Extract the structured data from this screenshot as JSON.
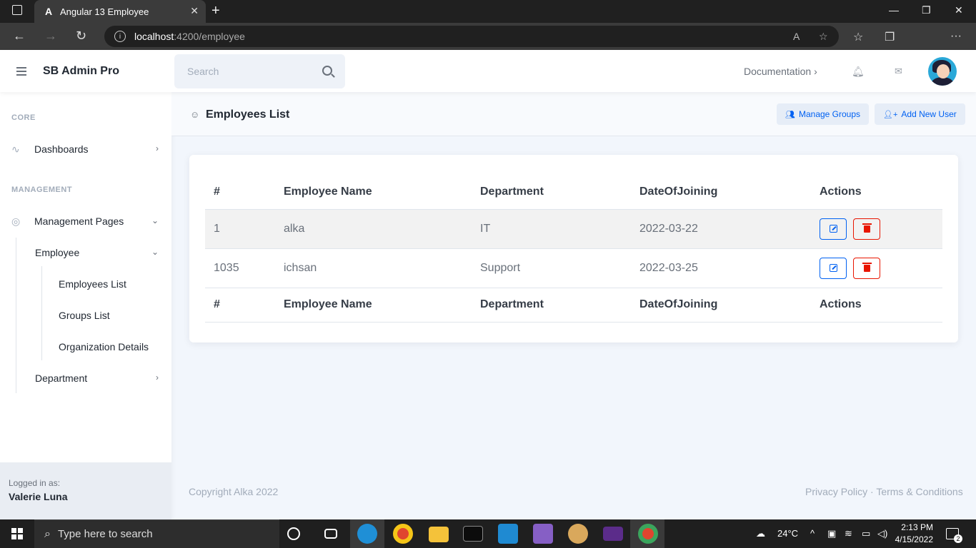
{
  "browser": {
    "tab_title": "Angular 13 Employee",
    "url_host": "localhost",
    "url_path": ":4200/employee"
  },
  "app": {
    "brand": "SB Admin Pro",
    "search_placeholder": "Search",
    "documentation": "Documentation"
  },
  "sidebar": {
    "core_heading": "CORE",
    "dashboards": "Dashboards",
    "management_heading": "MANAGEMENT",
    "management_pages": "Management Pages",
    "employee": "Employee",
    "employees_list": "Employees List",
    "groups_list": "Groups List",
    "organization_details": "Organization Details",
    "department": "Department",
    "logged_in_label": "Logged in as:",
    "logged_in_user": "Valerie Luna"
  },
  "page": {
    "title": "Employees List",
    "manage_groups": "Manage Groups",
    "add_new_user": "Add New User"
  },
  "table": {
    "headers": [
      "#",
      "Employee Name",
      "Department",
      "DateOfJoining",
      "Actions"
    ],
    "rows": [
      {
        "id": "1",
        "name": "alka",
        "department": "IT",
        "date": "2022-03-22"
      },
      {
        "id": "1035",
        "name": "ichsan",
        "department": "Support",
        "date": "2022-03-25"
      }
    ]
  },
  "footer": {
    "copyright": "Copyright Alka 2022",
    "links": "Privacy Policy · Terms & Conditions"
  },
  "taskbar": {
    "search_placeholder": "Type here to search",
    "temperature": "24°C",
    "time": "2:13 PM",
    "date": "4/15/2022",
    "notifications": "2"
  },
  "colors": {
    "primary": "#0061f2",
    "danger": "#e81500",
    "background": "#f2f6fc"
  }
}
